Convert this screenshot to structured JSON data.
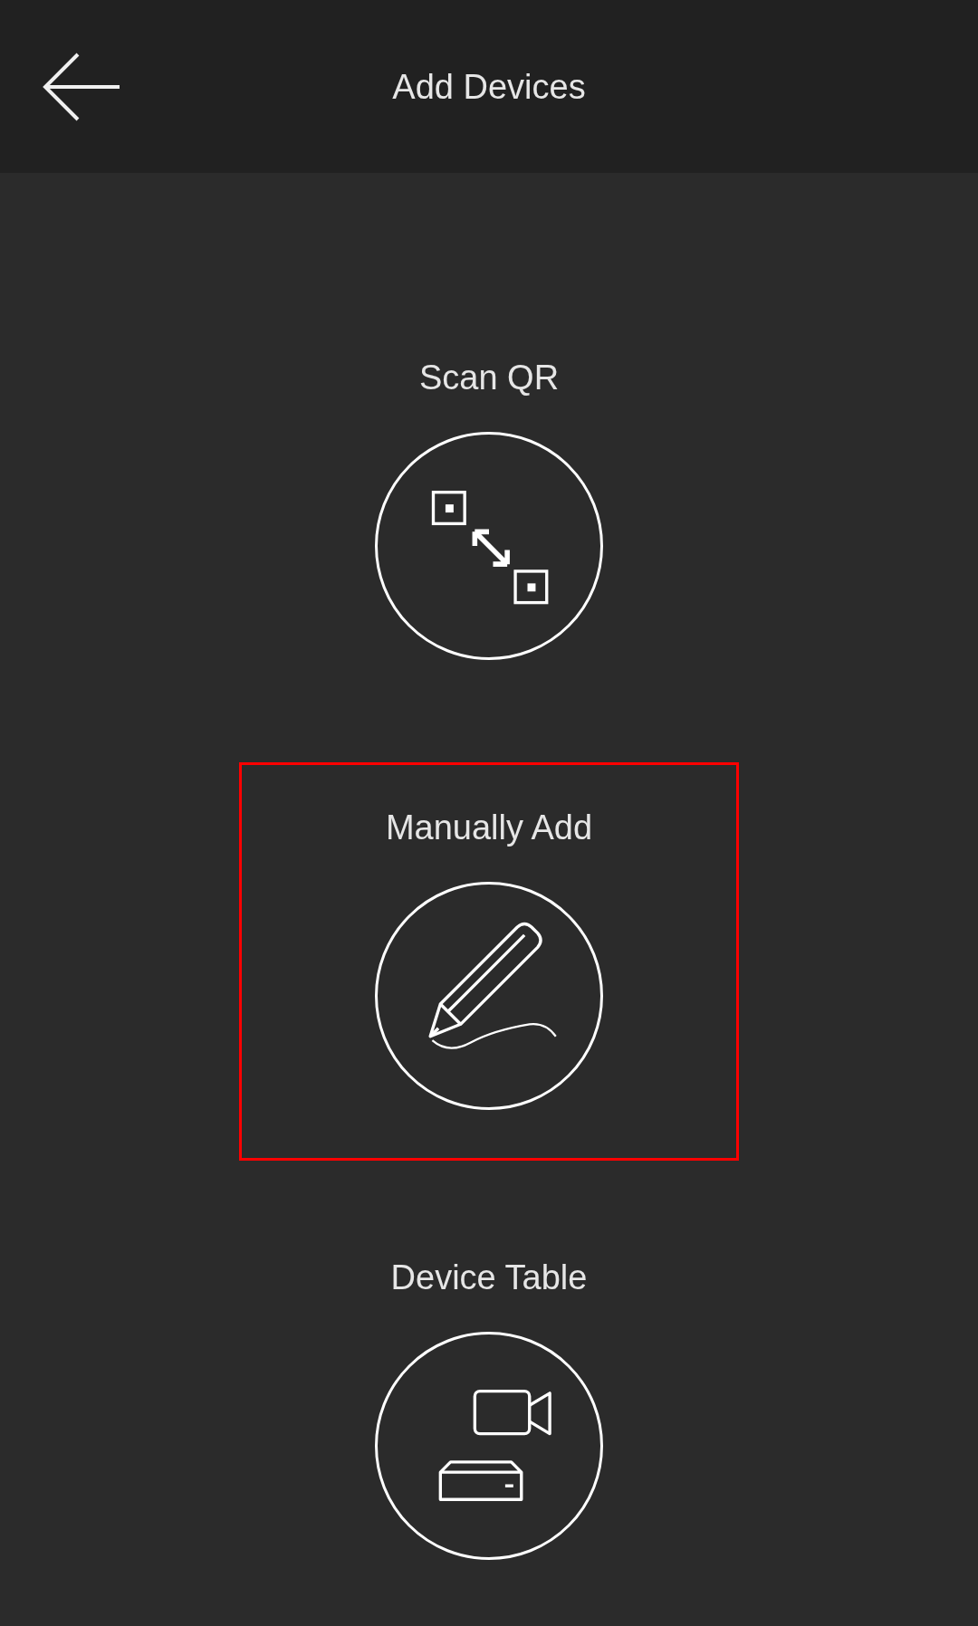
{
  "header": {
    "title": "Add Devices"
  },
  "options": [
    {
      "kind": "qr",
      "label": "Scan QR",
      "selected": false
    },
    {
      "kind": "manual",
      "label": "Manually Add",
      "selected": true
    },
    {
      "kind": "table",
      "label": "Device Table",
      "selected": false
    }
  ]
}
